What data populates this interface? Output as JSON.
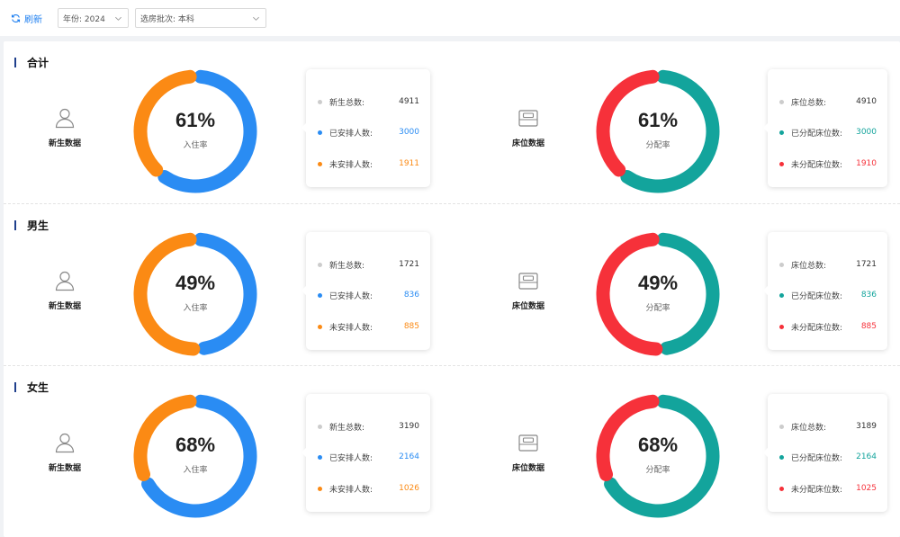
{
  "toolbar": {
    "refresh_label": "刷新",
    "year_select": {
      "label": "年份:",
      "value": "2024"
    },
    "batch_select": {
      "label": "选房批次:",
      "value": "本科"
    }
  },
  "colors": {
    "orange": "#fb8a14",
    "blue": "#2a8cf3",
    "red": "#f6313a",
    "teal": "#13a49c",
    "gray_dot": "#cccccc",
    "accent": "#1e7ff0"
  },
  "sections": [
    {
      "title": "合计",
      "students": {
        "category": "新生数据",
        "rate_label": "入住率",
        "percent": 61,
        "percent_text": "61%",
        "stats": [
          {
            "label": "新生总数:",
            "value": "4911"
          },
          {
            "label": "已安排人数:",
            "value": "3000"
          },
          {
            "label": "未安排人数:",
            "value": "1911"
          }
        ]
      },
      "beds": {
        "category": "床位数据",
        "rate_label": "分配率",
        "percent": 61,
        "percent_text": "61%",
        "stats": [
          {
            "label": "床位总数:",
            "value": "4910"
          },
          {
            "label": "已分配床位数:",
            "value": "3000"
          },
          {
            "label": "未分配床位数:",
            "value": "1910"
          }
        ]
      }
    },
    {
      "title": "男生",
      "students": {
        "category": "新生数据",
        "rate_label": "入住率",
        "percent": 49,
        "percent_text": "49%",
        "stats": [
          {
            "label": "新生总数:",
            "value": "1721"
          },
          {
            "label": "已安排人数:",
            "value": "836"
          },
          {
            "label": "未安排人数:",
            "value": "885"
          }
        ]
      },
      "beds": {
        "category": "床位数据",
        "rate_label": "分配率",
        "percent": 49,
        "percent_text": "49%",
        "stats": [
          {
            "label": "床位总数:",
            "value": "1721"
          },
          {
            "label": "已分配床位数:",
            "value": "836"
          },
          {
            "label": "未分配床位数:",
            "value": "885"
          }
        ]
      }
    },
    {
      "title": "女生",
      "students": {
        "category": "新生数据",
        "rate_label": "入住率",
        "percent": 68,
        "percent_text": "68%",
        "stats": [
          {
            "label": "新生总数:",
            "value": "3190"
          },
          {
            "label": "已安排人数:",
            "value": "2164"
          },
          {
            "label": "未安排人数:",
            "value": "1026"
          }
        ]
      },
      "beds": {
        "category": "床位数据",
        "rate_label": "分配率",
        "percent": 68,
        "percent_text": "68%",
        "stats": [
          {
            "label": "床位总数:",
            "value": "3189"
          },
          {
            "label": "已分配床位数:",
            "value": "2164"
          },
          {
            "label": "未分配床位数:",
            "value": "1025"
          }
        ]
      }
    }
  ]
}
